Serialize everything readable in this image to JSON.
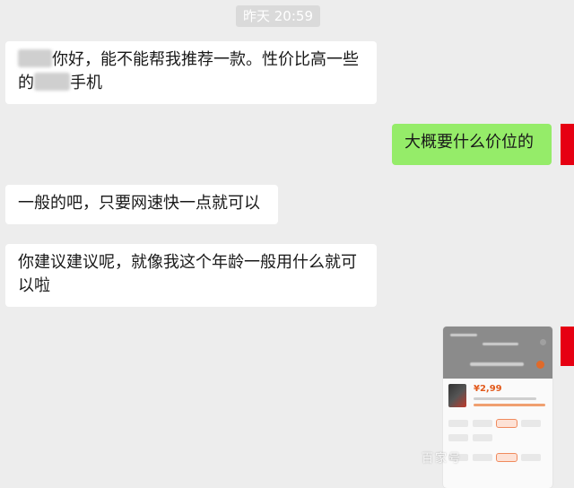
{
  "timestamp": "昨天 20:59",
  "messages": [
    {
      "side": "left",
      "line1": "你好，能不能帮我推荐一款。性价比高一些",
      "line2_pre": "的",
      "line2_post": "手机"
    },
    {
      "side": "right",
      "text": "大概要什么价位的"
    },
    {
      "side": "left",
      "text": "一般的吧，只要网速快一点就可以"
    },
    {
      "side": "left",
      "line1": "你建议建议呢，就像我这个年龄一般用什么就可",
      "line2": "以啦"
    }
  ],
  "image_message": {
    "price": "¥2,99"
  },
  "watermark": "百家号",
  "colors": {
    "background": "#ededed",
    "self_bubble": "#95ec69",
    "avatar": "#e60012"
  }
}
